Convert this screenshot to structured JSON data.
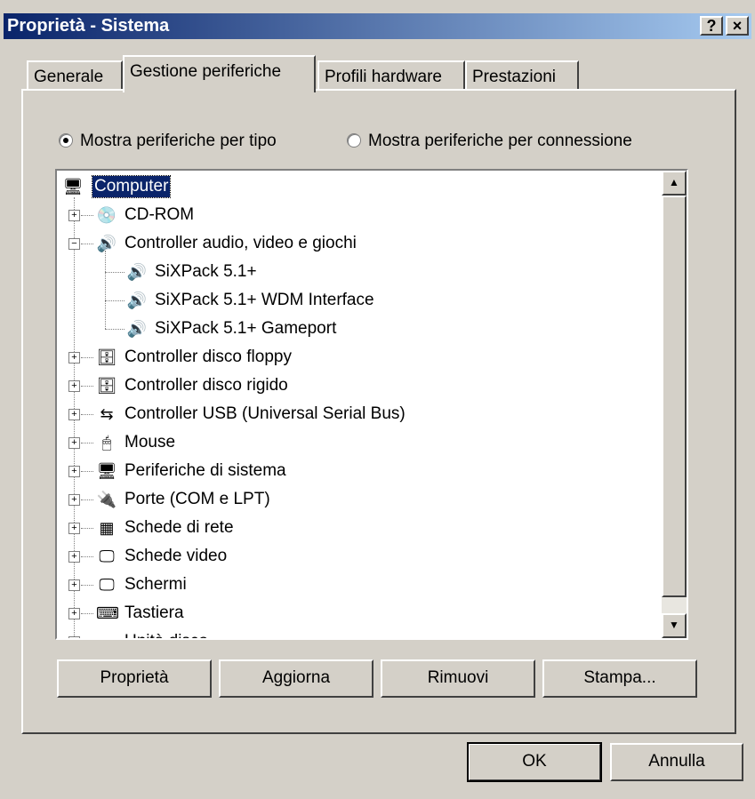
{
  "window": {
    "title": "Proprietà - Sistema",
    "help_label": "?",
    "close_label": "×"
  },
  "tabs": [
    {
      "label": "Generale"
    },
    {
      "label": "Gestione periferiche"
    },
    {
      "label": "Profili hardware"
    },
    {
      "label": "Prestazioni"
    }
  ],
  "view_options": {
    "by_type": {
      "label": "Mostra periferiche per tipo",
      "selected": true
    },
    "by_connection": {
      "label": "Mostra periferiche per connessione",
      "selected": false
    }
  },
  "tree": {
    "root": "Computer",
    "items": [
      {
        "label": "CD-ROM",
        "icon": "cdrom-icon",
        "expander": "+"
      },
      {
        "label": "Controller audio, video e giochi",
        "icon": "sound-controller-icon",
        "expander": "−"
      },
      {
        "label": "SiXPack 5.1+",
        "icon": "sound-controller-icon",
        "child": true
      },
      {
        "label": "SiXPack 5.1+ WDM Interface",
        "icon": "sound-controller-icon",
        "child": true
      },
      {
        "label": "SiXPack 5.1+ Gameport",
        "icon": "sound-controller-icon",
        "child": true
      },
      {
        "label": "Controller disco floppy",
        "icon": "disk-controller-icon",
        "expander": "+"
      },
      {
        "label": "Controller disco rigido",
        "icon": "disk-controller-icon",
        "expander": "+"
      },
      {
        "label": "Controller USB (Universal Serial Bus)",
        "icon": "usb-icon",
        "expander": "+"
      },
      {
        "label": "Mouse",
        "icon": "mouse-icon",
        "expander": "+"
      },
      {
        "label": "Periferiche di sistema",
        "icon": "system-device-icon",
        "expander": "+"
      },
      {
        "label": "Porte (COM e LPT)",
        "icon": "port-icon",
        "expander": "+"
      },
      {
        "label": "Schede di rete",
        "icon": "network-card-icon",
        "expander": "+"
      },
      {
        "label": "Schede video",
        "icon": "display-adapter-icon",
        "expander": "+"
      },
      {
        "label": "Schermi",
        "icon": "monitor-icon",
        "expander": "+"
      },
      {
        "label": "Tastiera",
        "icon": "keyboard-icon",
        "expander": "+"
      },
      {
        "label": "Unità disco",
        "icon": "disk-drive-icon",
        "expander": "+"
      }
    ]
  },
  "actions": {
    "properties": "Proprietà",
    "refresh": "Aggiorna",
    "remove": "Rimuovi",
    "print": "Stampa..."
  },
  "dialog": {
    "ok": "OK",
    "cancel": "Annulla"
  }
}
